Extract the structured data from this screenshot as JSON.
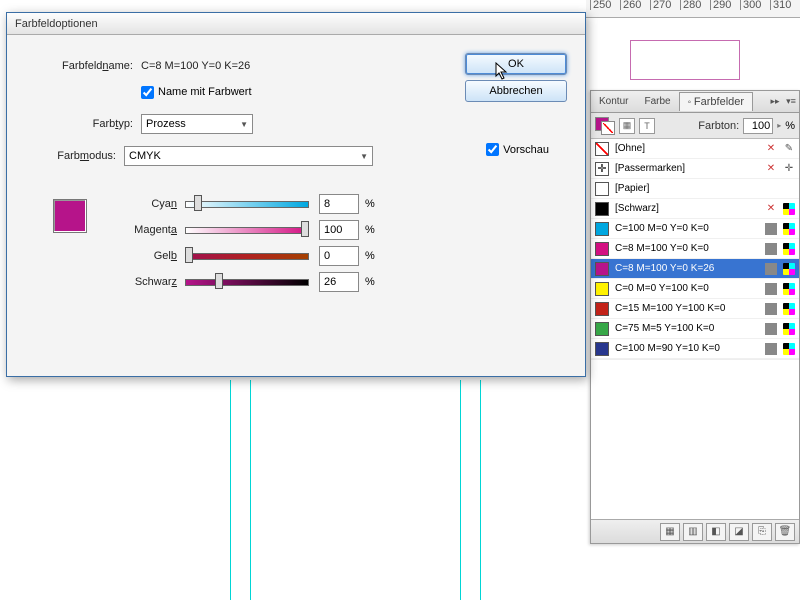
{
  "ruler": {
    "marks": [
      "250",
      "260",
      "270",
      "280",
      "290",
      "300",
      "310"
    ]
  },
  "panel": {
    "tabs": {
      "t1": "Kontur",
      "t2": "Farbe",
      "t3": "Farbfelder"
    },
    "tint_label": "Farbton:",
    "tint_value": "100",
    "tint_unit": "%",
    "swatches": [
      {
        "name": "[Ohne]",
        "chip": "none",
        "lock": true,
        "pencil": true
      },
      {
        "name": "[Passermarken]",
        "chip": "reg",
        "lock": true,
        "cmyk": false,
        "reg": true
      },
      {
        "name": "[Papier]",
        "chip": "#ffffff"
      },
      {
        "name": "[Schwarz]",
        "chip": "#000000",
        "lock": true,
        "cmyk": true
      },
      {
        "name": "C=100 M=0 Y=0 K=0",
        "chip": "#00a7e0",
        "cmyk": true,
        "global": true
      },
      {
        "name": "C=8 M=100 Y=0 K=0",
        "chip": "#d31082",
        "cmyk": true,
        "global": true
      },
      {
        "name": "C=8 M=100 Y=0 K=26",
        "chip": "#b6148a",
        "cmyk": true,
        "global": true,
        "selected": true
      },
      {
        "name": "C=0 M=0 Y=100 K=0",
        "chip": "#fff200",
        "cmyk": true,
        "global": true
      },
      {
        "name": "C=15 M=100 Y=100 K=0",
        "chip": "#c3231a",
        "cmyk": true,
        "global": true
      },
      {
        "name": "C=75 M=5 Y=100 K=0",
        "chip": "#37a748",
        "cmyk": true,
        "global": true
      },
      {
        "name": "C=100 M=90 Y=10 K=0",
        "chip": "#28378e",
        "cmyk": true,
        "global": true
      }
    ]
  },
  "dialog": {
    "title": "Farbfeldoptionen",
    "name_label": "Farbfeldname:",
    "name_value": "C=8 M=100 Y=0 K=26",
    "name_with_value": "Name mit Farbwert",
    "type_label": "Farbtyp:",
    "type_value": "Prozess",
    "mode_label": "Farbmodus:",
    "mode_value": "CMYK",
    "channels": {
      "cyan": {
        "label": "Cyan",
        "value": "8",
        "pct": 8,
        "grad": "linear-gradient(to right,#fff,#00a7e0)"
      },
      "magenta": {
        "label": "Magenta",
        "value": "100",
        "pct": 100,
        "grad": "linear-gradient(to right,#fff,#d31082)"
      },
      "yellow": {
        "label": "Gelb",
        "value": "0",
        "pct": 0,
        "grad": "linear-gradient(to right,#a01050,#b02020,#a54000)"
      },
      "black": {
        "label": "Schwarz",
        "value": "26",
        "pct": 26,
        "grad": "linear-gradient(to right,#b6148a,#000)"
      }
    },
    "unit": "%",
    "ok": "OK",
    "cancel": "Abbrechen",
    "preview": "Vorschau"
  }
}
